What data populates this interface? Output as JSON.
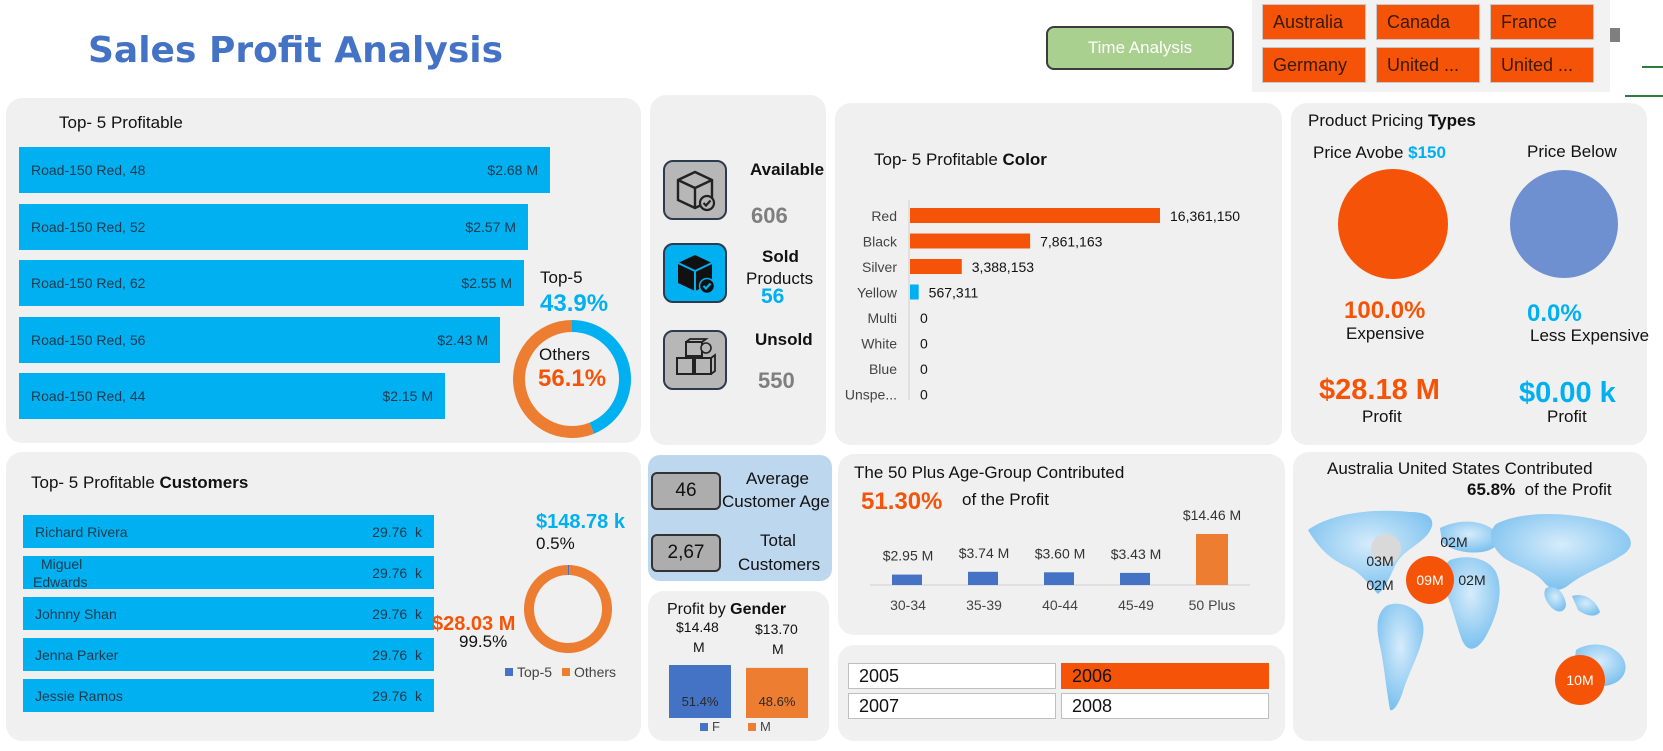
{
  "title": "Sales Profit Analysis",
  "time_button": "Time Analysis",
  "country_slicer": [
    "Australia",
    "Canada",
    "France",
    "Germany",
    "United ...",
    "United ..."
  ],
  "top5_profitable": {
    "title": "Top- 5 Profitable",
    "items": [
      {
        "label": "Road-150 Red, 48",
        "value_text": "$2.68 M",
        "value": 2.68
      },
      {
        "label": "Road-150 Red, 52",
        "value_text": "$2.57 M",
        "value": 2.57
      },
      {
        "label": "Road-150 Red, 62",
        "value_text": "$2.55 M",
        "value": 2.55
      },
      {
        "label": "Road-150 Red, 56",
        "value_text": "$2.43 M",
        "value": 2.43
      },
      {
        "label": "Road-150 Red, 44",
        "value_text": "$2.15 M",
        "value": 2.15
      }
    ],
    "donut_top_label": "Top-5",
    "donut_top_pct": "43.9%",
    "donut_others_label": "Others",
    "donut_others_pct": "56.1%"
  },
  "inventory": {
    "available_label": "Available",
    "available_value": "606",
    "sold_label": "Sold",
    "sold_label2": "Products",
    "sold_value": "56",
    "unsold_label": "Unsold",
    "unsold_value": "550"
  },
  "colors": {
    "orange": "#f55408",
    "blue": "#00b0f0",
    "steel": "#4472c4",
    "soft_orange": "#ed7d31",
    "lavender": "#6e8fd0"
  },
  "top5_customers": {
    "title_a": "Top- 5 Profitable ",
    "title_b": "Customers",
    "items": [
      {
        "name": "Richard Rivera",
        "value_text": "29.76  k"
      },
      {
        "name": "Miguel Edwards",
        "name_line1": "Miguel",
        "name_line2": "Edwards",
        "value_text": "29.76  k"
      },
      {
        "name": "Johnny Shan",
        "value_text": "29.76  k"
      },
      {
        "name": "Jenna Parker",
        "value_text": "29.76  k"
      },
      {
        "name": "Jessie Ramos",
        "value_text": "29.76  k"
      }
    ],
    "top_amount": "$148.78  k",
    "top_pct": "0.5%",
    "others_amount": "$28.03 M",
    "others_pct": "99.5%",
    "legend": [
      "Top-5",
      "Others"
    ]
  },
  "customer_stats": {
    "avg_age_value": "46",
    "avg_age_label1": "Average",
    "avg_age_label2": "Customer Age",
    "total_value": "2,67",
    "total_label1": "Total",
    "total_label2": "Customers"
  },
  "gender": {
    "title_a": "Profit by ",
    "title_b": "Gender",
    "f_value_line1": "$14.48",
    "f_value_line2": "M",
    "m_value_line1": "$13.70",
    "m_value_line2": "M",
    "f_pct": "51.4%",
    "m_pct": "48.6%",
    "legend": [
      "F",
      "M"
    ]
  },
  "age_group": {
    "title": "The 50 Plus Age-Group Contributed",
    "pct": "51.30%",
    "suffix": "of the Profit"
  },
  "years": [
    "2005",
    "2006",
    "2007",
    "2008"
  ],
  "pricing": {
    "title_a": "Product Pricing ",
    "title_b": "Types",
    "above_label": "Price Avobe ",
    "above_threshold": "$150",
    "below_label": "Price Below",
    "above_pct": "100.0%",
    "above_type": "Expensive",
    "below_pct": "0.0%",
    "below_type": "Less Expensive",
    "above_profit": "$28.18 M",
    "below_profit": "$0.00  k",
    "profit_label": "Profit"
  },
  "map": {
    "title": "Australia United States Contributed",
    "pct": "65.8%",
    "suffix": "of the Profit",
    "bubbles": [
      "02M",
      "03M",
      "09M",
      "02M",
      "02M",
      "10M"
    ]
  },
  "chart_data": [
    {
      "type": "bar",
      "title": "Top- 5 Profitable Color",
      "categories": [
        "Red",
        "Black",
        "Silver",
        "Yellow",
        "Multi",
        "White",
        "Blue",
        "Unspe..."
      ],
      "values": [
        16361150,
        7861163,
        3388153,
        567311,
        0,
        0,
        0,
        0
      ],
      "labels": [
        "16,361,150",
        "7,861,163",
        "3,388,153",
        "567,311",
        "0",
        "0",
        "0",
        "0"
      ]
    },
    {
      "type": "bar",
      "title": "The 50 Plus Age-Group Contributed",
      "categories": [
        "30-34",
        "35-39",
        "40-44",
        "45-49",
        "50 Plus"
      ],
      "values": [
        2.95,
        3.74,
        3.6,
        3.43,
        14.46
      ],
      "labels": [
        "$2.95 M",
        "$3.74 M",
        "$3.60 M",
        "$3.43 M",
        "$14.46 M"
      ]
    },
    {
      "type": "pie",
      "categories": [
        "Top-5",
        "Others"
      ],
      "values": [
        43.9,
        56.1
      ]
    },
    {
      "type": "pie",
      "categories": [
        "Top-5",
        "Others"
      ],
      "values": [
        0.5,
        99.5
      ]
    },
    {
      "type": "bar",
      "title": "Profit by Gender",
      "categories": [
        "F",
        "M"
      ],
      "values": [
        14.48,
        13.7
      ]
    }
  ]
}
